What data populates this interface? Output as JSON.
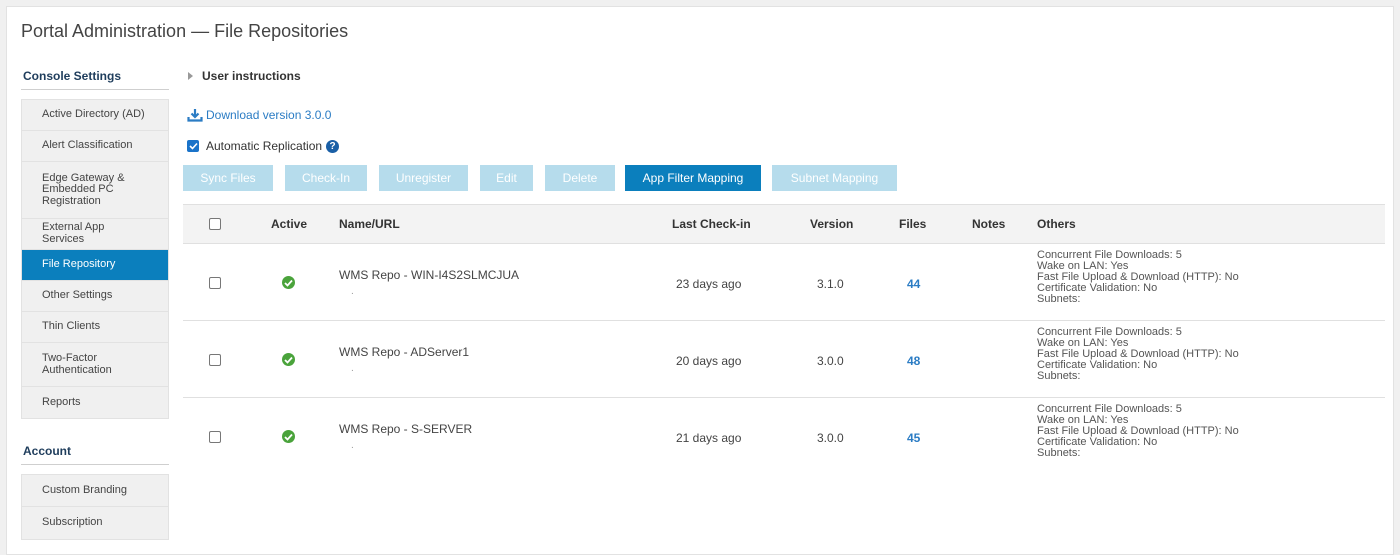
{
  "page": {
    "title": "Portal Administration — File Repositories"
  },
  "sidebar": {
    "console_heading": "Console Settings",
    "console_items": [
      {
        "label": "Active Directory (AD)",
        "active": false
      },
      {
        "label": "Alert Classification",
        "active": false
      },
      {
        "label": "Edge Gateway & Embedded PC Registration",
        "active": false
      },
      {
        "label": "External App Services",
        "active": false
      },
      {
        "label": "File Repository",
        "active": true
      },
      {
        "label": "Other Settings",
        "active": false
      },
      {
        "label": "Thin Clients",
        "active": false
      },
      {
        "label": "Two-Factor Authentication",
        "active": false
      },
      {
        "label": "Reports",
        "active": false
      }
    ],
    "account_heading": "Account",
    "account_items": [
      {
        "label": "Custom Branding"
      },
      {
        "label": "Subscription"
      }
    ]
  },
  "main": {
    "instructions_label": "User instructions",
    "download_label": "Download version 3.0.0",
    "auto_replication": {
      "label": "Automatic Replication",
      "checked": true
    },
    "toolbar": {
      "sync": "Sync Files",
      "checkin": "Check-In",
      "unregister": "Unregister",
      "edit": "Edit",
      "delete": "Delete",
      "app_filter": "App Filter Mapping",
      "subnet": "Subnet Mapping"
    },
    "table": {
      "columns": {
        "active": "Active",
        "name": "Name/URL",
        "last_checkin": "Last Check-in",
        "version": "Version",
        "files": "Files",
        "notes": "Notes",
        "others": "Others"
      },
      "rows": [
        {
          "name": "WMS Repo - WIN-I4S2SLMCJUA",
          "url": ".",
          "last_checkin": "23 days ago",
          "version": "3.1.0",
          "files": "44",
          "others": [
            "Concurrent File Downloads: 5",
            "Wake on LAN: Yes",
            "Fast File Upload & Download (HTTP): No",
            "Certificate Validation: No",
            "Subnets:"
          ]
        },
        {
          "name": "WMS Repo - ADServer1",
          "url": ".",
          "last_checkin": "20 days ago",
          "version": "3.0.0",
          "files": "48",
          "others": [
            "Concurrent File Downloads: 5",
            "Wake on LAN: Yes",
            "Fast File Upload & Download (HTTP): No",
            "Certificate Validation: No",
            "Subnets:"
          ]
        },
        {
          "name": "WMS Repo - S-SERVER",
          "url": ".",
          "last_checkin": "21 days ago",
          "version": "3.0.0",
          "files": "45",
          "others": [
            "Concurrent File Downloads: 5",
            "Wake on LAN: Yes",
            "Fast File Upload & Download (HTTP): No",
            "Certificate Validation: No",
            "Subnets:"
          ]
        }
      ]
    }
  }
}
